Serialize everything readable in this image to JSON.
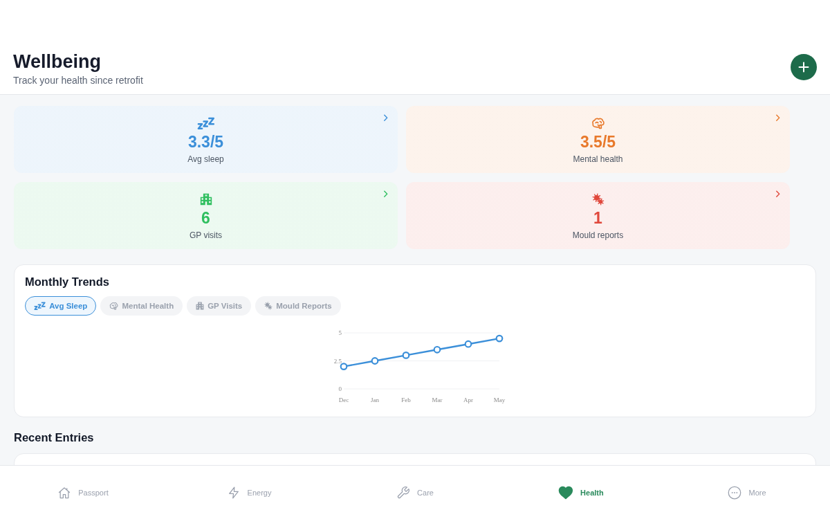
{
  "header": {
    "title": "Wellbeing",
    "subtitle": "Track your health since retrofit"
  },
  "stats": [
    {
      "kind": "sleep",
      "value": "3.3/5",
      "label": "Avg sleep",
      "color": "#3b8fd9"
    },
    {
      "kind": "mental",
      "value": "3.5/5",
      "label": "Mental health",
      "color": "#e8792b"
    },
    {
      "kind": "gp",
      "value": "6",
      "label": "GP visits",
      "color": "#2fbf5f"
    },
    {
      "kind": "mould",
      "value": "1",
      "label": "Mould reports",
      "color": "#e0483c"
    }
  ],
  "trends": {
    "title": "Monthly Trends",
    "tabs": [
      {
        "kind": "sleep",
        "label": "Avg Sleep",
        "selected": true
      },
      {
        "kind": "mental",
        "label": "Mental Health",
        "selected": false
      },
      {
        "kind": "gp",
        "label": "GP Visits",
        "selected": false
      },
      {
        "kind": "mould",
        "label": "Mould Reports",
        "selected": false
      }
    ],
    "chart_data": {
      "type": "line",
      "categories": [
        "Dec",
        "Jan",
        "Feb",
        "Mar",
        "Apr",
        "May"
      ],
      "series": [
        {
          "color": "#3b8fd9",
          "marker": "circle",
          "values": [
            2.0,
            2.5,
            3.0,
            3.5,
            4.0,
            4.5
          ]
        }
      ],
      "ylim": [
        0,
        5
      ],
      "yticks": [
        0,
        2.5,
        5
      ]
    }
  },
  "recent": {
    "title": "Recent Entries"
  },
  "nav": [
    {
      "kind": "passport",
      "label": "Passport",
      "selected": false
    },
    {
      "kind": "energy",
      "label": "Energy",
      "selected": false
    },
    {
      "kind": "care",
      "label": "Care",
      "selected": false
    },
    {
      "kind": "health",
      "label": "Health",
      "selected": true
    },
    {
      "kind": "more",
      "label": "More",
      "selected": false
    }
  ]
}
